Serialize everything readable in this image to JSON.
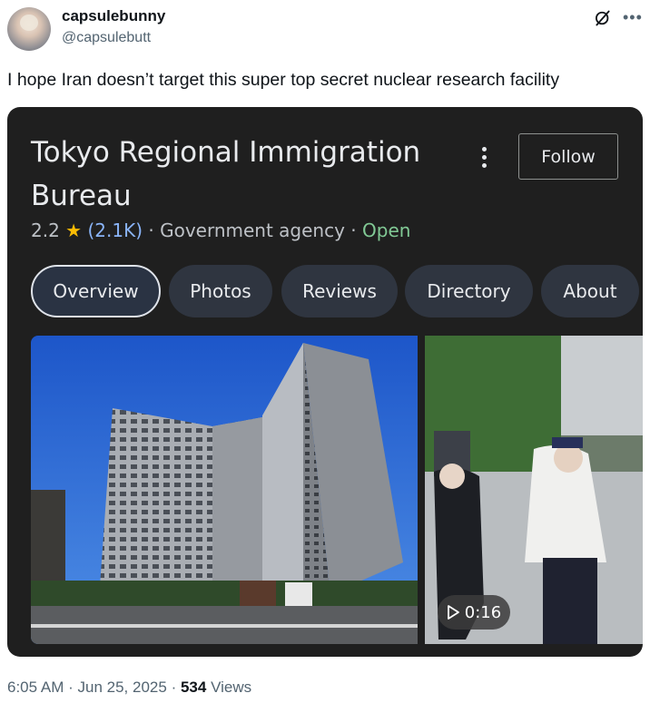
{
  "author": {
    "display_name": "capsulebunny",
    "handle": "@capsulebutt"
  },
  "tweet": {
    "text": "I hope Iran doesn’t target this super top secret nuclear research facility",
    "time": "6:05 AM",
    "date": "Jun 25, 2025",
    "views_count": "534",
    "views_label": "Views",
    "sep": "·"
  },
  "card": {
    "title": "Tokyo Regional Immigration Bureau",
    "follow_label": "Follow",
    "rating": "2.2",
    "review_count": "(2.1K)",
    "category": "Government agency",
    "status": "Open",
    "sep": "·",
    "tabs": [
      {
        "label": "Overview"
      },
      {
        "label": "Photos"
      },
      {
        "label": "Reviews"
      },
      {
        "label": "Directory"
      },
      {
        "label": "About"
      }
    ],
    "video_duration": "0:16"
  },
  "colors": {
    "card_bg": "#1f1f1f",
    "open_status": "#81c995",
    "review_link": "#8ab4f8",
    "star": "#fbbc04"
  },
  "icons": [
    "grok-icon",
    "more-icon",
    "kebab-menu-icon",
    "star-icon",
    "play-icon"
  ]
}
